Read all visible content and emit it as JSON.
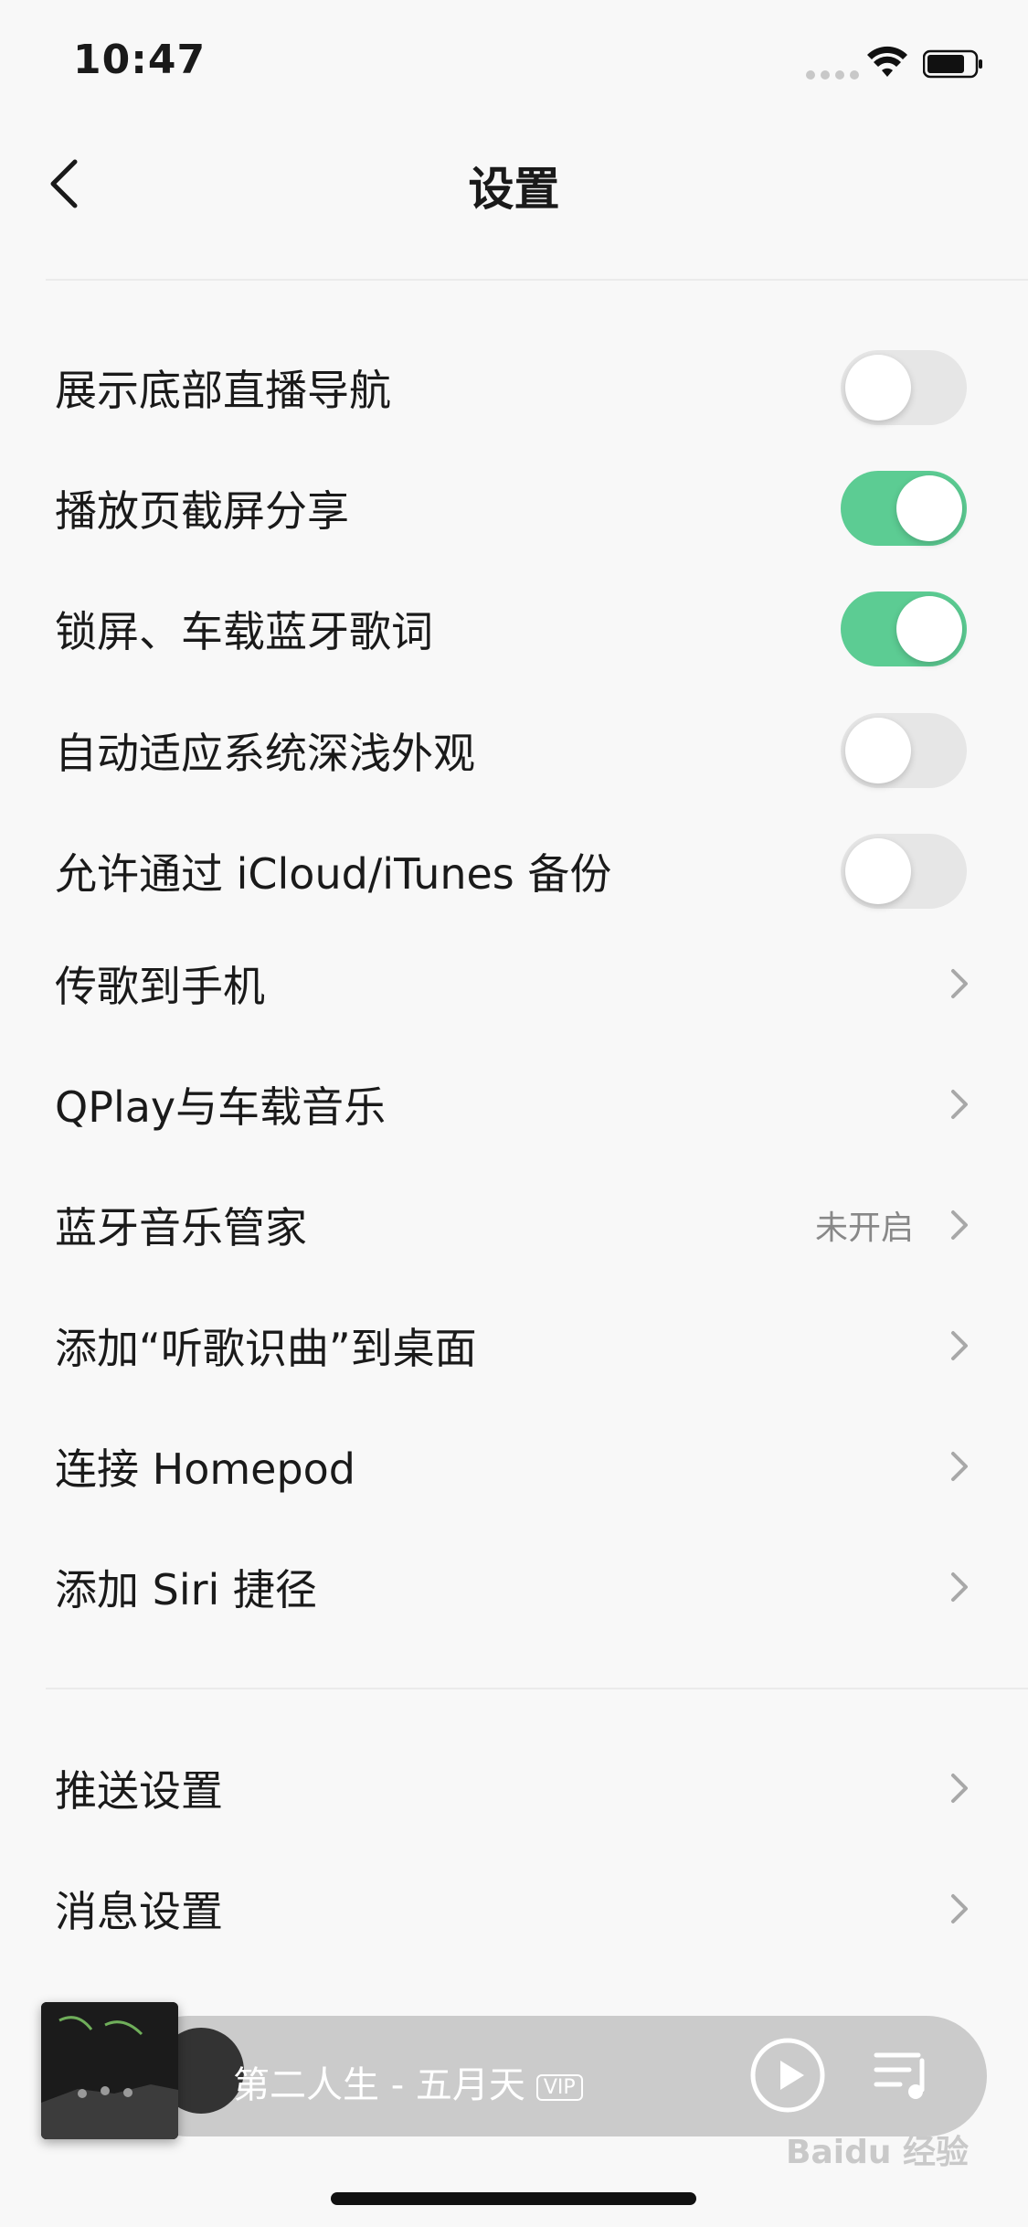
{
  "status": {
    "time": "10:47"
  },
  "nav": {
    "title": "设置"
  },
  "settings": {
    "show_live_nav": {
      "label": "展示底部直播导航",
      "on": false
    },
    "screenshot_share": {
      "label": "播放页截屏分享",
      "on": true
    },
    "lockscreen_lyrics": {
      "label": "锁屏、车载蓝牙歌词",
      "on": true
    },
    "auto_dark_mode": {
      "label": "自动适应系统深浅外观",
      "on": false
    },
    "icloud_backup": {
      "label": "允许通过 iCloud/iTunes 备份",
      "on": false
    },
    "transfer_songs": {
      "label": "传歌到手机"
    },
    "qplay": {
      "label": "QPlay与车载音乐"
    },
    "bluetooth_butler": {
      "label": "蓝牙音乐管家",
      "value": "未开启"
    },
    "add_song_recognition": {
      "label": "添加“听歌识曲”到桌面"
    },
    "homepod": {
      "label": "连接 Homepod"
    },
    "siri_shortcut": {
      "label": "添加 Siri 捷径"
    },
    "push_settings": {
      "label": "推送设置"
    },
    "message_settings": {
      "label": "消息设置"
    }
  },
  "player": {
    "track": "第二人生 - 五月天",
    "badge": "VIP"
  },
  "watermark": "Baidu 经验",
  "colors": {
    "toggle_on": "#5ccc93",
    "toggle_off": "#e6e6e6",
    "background": "#f8f8f8"
  }
}
